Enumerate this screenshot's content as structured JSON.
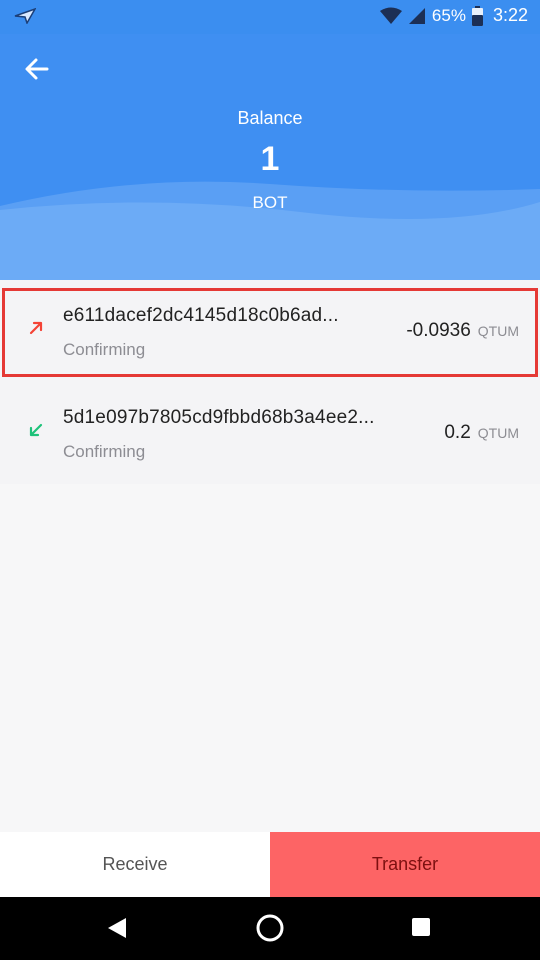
{
  "status_bar": {
    "battery": "65%",
    "time": "3:22"
  },
  "header": {
    "balance_label": "Balance",
    "balance_value": "1",
    "balance_unit": "BOT",
    "accent_color": "#3f8ff2"
  },
  "transactions": [
    {
      "id": "e611dacef2dc4145d18c0b6ad...",
      "status": "Confirming",
      "amount": "-0.0936",
      "currency": "QTUM",
      "direction": "outgoing",
      "icon": "arrow-up-right-icon",
      "icon_color": "#f44336"
    },
    {
      "id": "5d1e097b7805cd9fbbd68b3a4ee2...",
      "status": "Confirming",
      "amount": "0.2",
      "currency": "QTUM",
      "direction": "incoming",
      "icon": "arrow-down-left-icon",
      "icon_color": "#1ec27a"
    }
  ],
  "actions": {
    "receive_label": "Receive",
    "transfer_label": "Transfer",
    "transfer_color": "#fd6465"
  }
}
